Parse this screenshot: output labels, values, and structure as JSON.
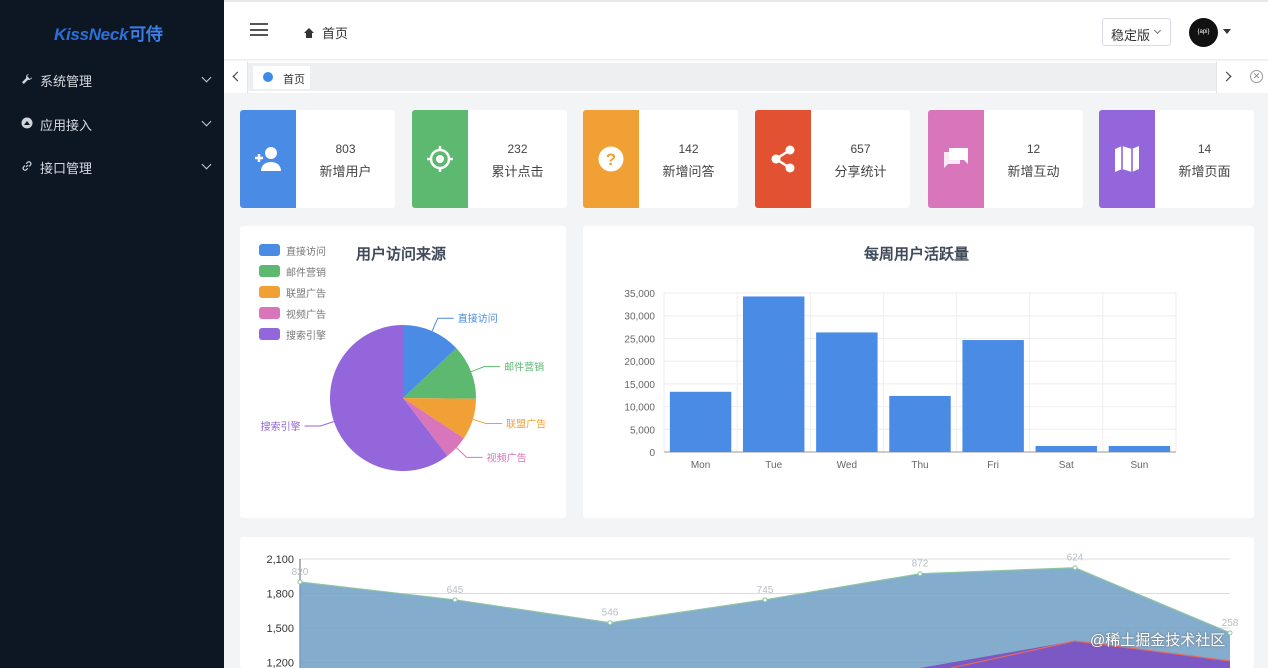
{
  "app": {
    "logo_text": "KissNeck",
    "logo_suffix": "可侍"
  },
  "sidebar": {
    "items": [
      {
        "label": "系统管理",
        "icon": "wrench-icon"
      },
      {
        "label": "应用接入",
        "icon": "app-icon"
      },
      {
        "label": "接口管理",
        "icon": "link-icon"
      }
    ]
  },
  "header": {
    "breadcrumb": "首页",
    "version_select": "稳定版",
    "avatar_text": "{api}"
  },
  "tabs": {
    "items": [
      {
        "label": "首页"
      }
    ]
  },
  "stats": [
    {
      "value": "803",
      "label": "新增用户",
      "color": "#4a8be6",
      "icon": "add-user-icon"
    },
    {
      "value": "232",
      "label": "累计点击",
      "color": "#5cb96f",
      "icon": "target-icon"
    },
    {
      "value": "142",
      "label": "新增问答",
      "color": "#f0a034",
      "icon": "question-icon"
    },
    {
      "value": "657",
      "label": "分享统计",
      "color": "#e25232",
      "icon": "share-icon"
    },
    {
      "value": "12",
      "label": "新增互动",
      "color": "#d976bb",
      "icon": "chat-icon"
    },
    {
      "value": "14",
      "label": "新增页面",
      "color": "#9466dc",
      "icon": "map-icon"
    }
  ],
  "chart_data": [
    {
      "type": "pie",
      "title": "用户访问来源",
      "legend_position": "top-left",
      "categories": [
        "直接访问",
        "邮件营销",
        "联盟广告",
        "视频广告",
        "搜索引擎"
      ],
      "values": [
        335,
        310,
        234,
        135,
        1548
      ],
      "colors": [
        "#4a8be6",
        "#5cb96f",
        "#f0a034",
        "#d976bb",
        "#9466dc"
      ]
    },
    {
      "type": "bar",
      "title": "每周用户活跃量",
      "categories": [
        "Mon",
        "Tue",
        "Wed",
        "Thu",
        "Fri",
        "Sat",
        "Sun"
      ],
      "values": [
        13253,
        34235,
        26321,
        12340,
        24643,
        1322,
        1324
      ],
      "ylim": [
        0,
        35000
      ],
      "yticks": [
        "35,000",
        "30,000",
        "25,000",
        "20,000",
        "15,000",
        "10,000",
        "5,000",
        "0"
      ],
      "grid": true,
      "color": "#4a8be6"
    },
    {
      "type": "area",
      "series": [
        {
          "values": [
            1900,
            1745,
            1546,
            1745,
            1972,
            2024,
            1458
          ],
          "labels": [
            "820",
            "645",
            "546",
            "745",
            "872",
            "624",
            "258"
          ],
          "color": "#6f9dc4"
        }
      ],
      "yticks": [
        "2,100",
        "1,800",
        "1,500",
        "1,200"
      ],
      "ylim_visible": [
        1200,
        2100
      ]
    }
  ],
  "watermark": "@稀土掘金技术社区"
}
